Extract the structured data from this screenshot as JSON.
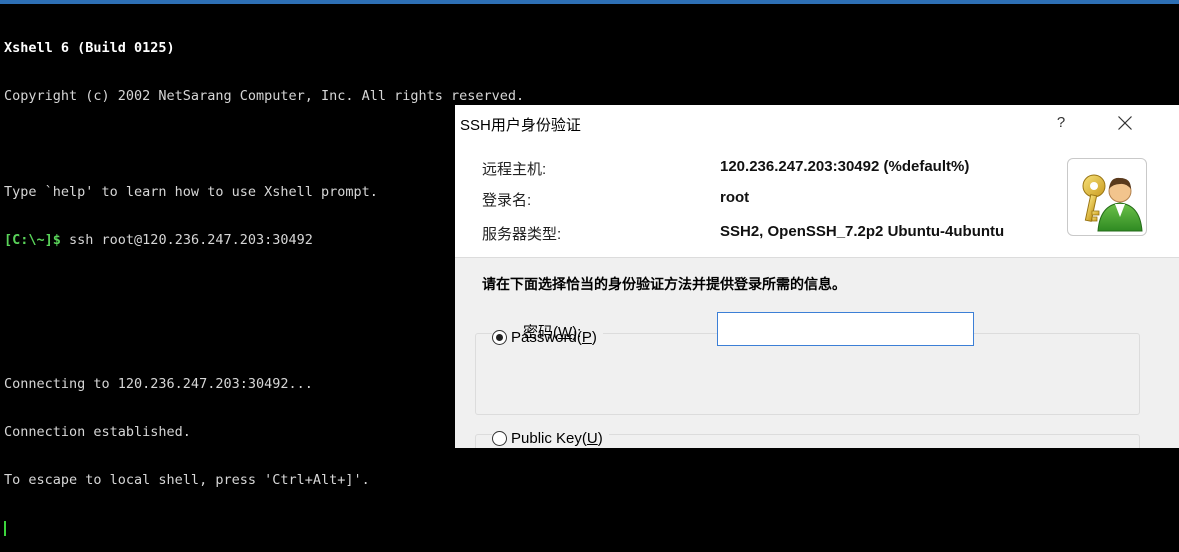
{
  "terminal": {
    "lines": [
      "Xshell 6 (Build 0125)",
      "Copyright (c) 2002 NetSarang Computer, Inc. All rights reserved.",
      "",
      "Type `help' to learn how to use Xshell prompt.",
      "ssh root@120.236.247.203:30492",
      "",
      "",
      "Connecting to 120.236.247.203:30492...",
      "Connection established.",
      "To escape to local shell, press 'Ctrl+Alt+]'."
    ],
    "prompt": "[C:\\~]$",
    "command": " ssh root@120.236.247.203:30492",
    "cursor_color": "#3cd43c",
    "prompt_color": "#5ad45a"
  },
  "dialog": {
    "title": "SSH用户身份验证",
    "help_label": "?",
    "close_icon": "close-icon",
    "remote_host_label": "远程主机:",
    "remote_host_value": "120.236.247.203:30492 (%default%)",
    "login_label": "登录名:",
    "login_value": "root",
    "server_type_label": "服务器类型:",
    "server_type_value": "SSH2, OpenSSH_7.2p2 Ubuntu-4ubuntu",
    "instruction": "请在下面选择恰当的身份验证方法并提供登录所需的信息。",
    "password_option": {
      "label": "Password",
      "mnemonic": "P",
      "checked": true
    },
    "password_field": {
      "label": "密码",
      "mnemonic": "W",
      "value": ""
    },
    "public_key_option": {
      "label": "Public Key",
      "mnemonic": "U",
      "checked": false
    },
    "avatar_icon": "user-key-icon",
    "accent_color": "#3c7fd6"
  }
}
